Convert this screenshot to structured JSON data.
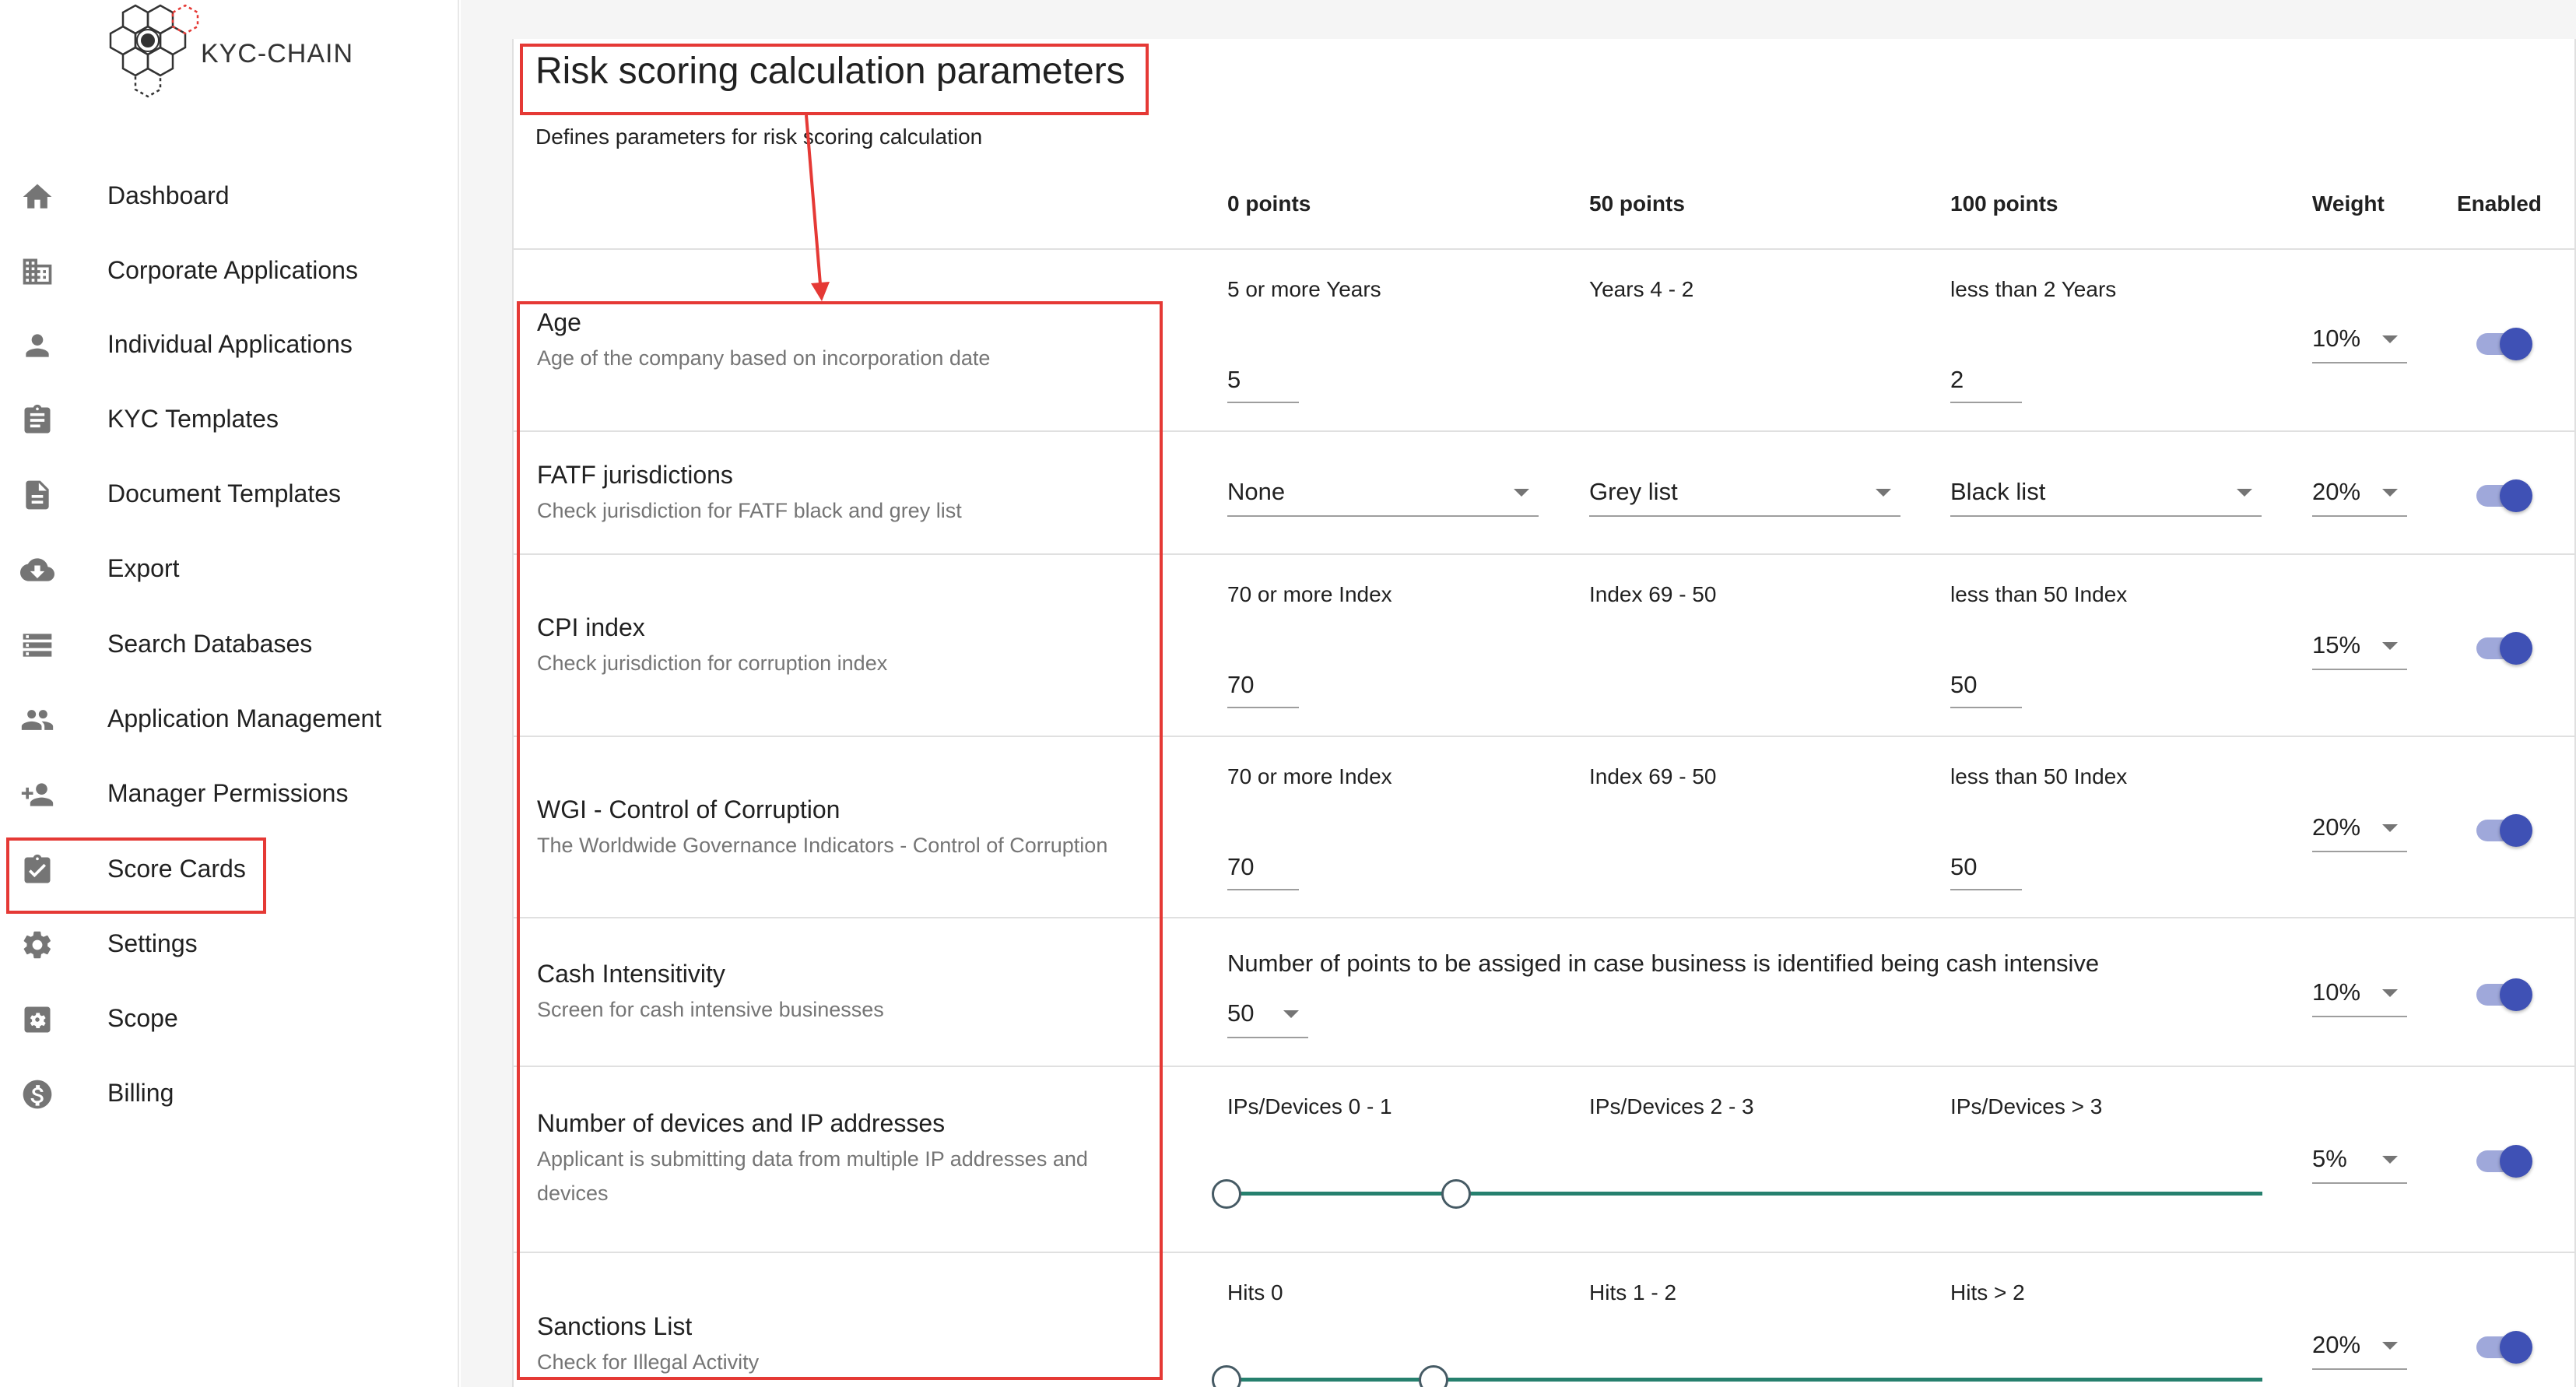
{
  "app": {
    "logo_text": "KYC-CHAIN"
  },
  "sidebar": {
    "items": [
      {
        "label": "Dashboard",
        "icon": "home-icon"
      },
      {
        "label": "Corporate Applications",
        "icon": "building-icon"
      },
      {
        "label": "Individual Applications",
        "icon": "person-icon"
      },
      {
        "label": "KYC Templates",
        "icon": "clipboard-icon"
      },
      {
        "label": "Document Templates",
        "icon": "document-icon"
      },
      {
        "label": "Export",
        "icon": "cloud-download-icon"
      },
      {
        "label": "Search Databases",
        "icon": "list-icon"
      },
      {
        "label": "Application Management",
        "icon": "people-icon"
      },
      {
        "label": "Manager Permissions",
        "icon": "add-people-icon"
      },
      {
        "label": "Score Cards",
        "icon": "clipboard-check-icon",
        "active": true
      },
      {
        "label": "Settings",
        "icon": "gear-icon"
      },
      {
        "label": "Scope",
        "icon": "scope-icon"
      },
      {
        "label": "Billing",
        "icon": "dollar-icon"
      }
    ]
  },
  "page": {
    "title": "Risk scoring calculation parameters",
    "subtitle": "Defines parameters for risk scoring calculation"
  },
  "columns": {
    "p0": "0 points",
    "p50": "50 points",
    "p100": "100 points",
    "weight": "Weight",
    "enabled": "Enabled"
  },
  "rows": {
    "age": {
      "title": "Age",
      "desc": "Age of the company based on incorporation date",
      "label0": "5 or more Years",
      "label50": "Years 4 - 2",
      "label100": "less than 2 Years",
      "value0": "5",
      "value100": "2",
      "weight": "10%",
      "enabled": true
    },
    "fatf": {
      "title": "FATF jurisdictions",
      "desc": "Check jurisdiction for FATF black and grey list",
      "select0": "None",
      "select50": "Grey list",
      "select100": "Black list",
      "weight": "20%",
      "enabled": true
    },
    "cpi": {
      "title": "CPI index",
      "desc": "Check jurisdiction for corruption index",
      "label0": "70 or more Index",
      "label50": "Index 69 - 50",
      "label100": "less than 50 Index",
      "value0": "70",
      "value100": "50",
      "weight": "15%",
      "enabled": true
    },
    "wgi": {
      "title": "WGI - Control of Corruption",
      "desc": "The Worldwide Governance Indicators - Control of Corruption",
      "label0": "70 or more Index",
      "label50": "Index 69 - 50",
      "label100": "less than 50 Index",
      "value0": "70",
      "value100": "50",
      "weight": "20%",
      "enabled": true
    },
    "cash": {
      "title": "Cash Intensitivity",
      "desc": "Screen for cash intensive businesses",
      "label": "Number of points to be assiged in case business is identified being cash intensive",
      "points": "50",
      "weight": "10%",
      "enabled": true
    },
    "devices": {
      "title": "Number of devices and IP addresses",
      "desc": "Applicant is submitting data from multiple IP addresses and devices",
      "label0": "IPs/Devices 0 - 1",
      "label50": "IPs/Devices 2 - 3",
      "label100": "IPs/Devices > 3",
      "range": [
        1,
        3
      ],
      "weight": "5%",
      "enabled": true
    },
    "sanctions": {
      "title": "Sanctions List",
      "desc": "Check for Illegal Activity",
      "label0": "Hits 0",
      "label50": "Hits 1 - 2",
      "label100": "Hits > 2",
      "weight": "20%",
      "enabled": true
    }
  },
  "colors": {
    "accent": "#3f51b5",
    "toggle_track": "#9fa8da",
    "slider_track": "#26806e",
    "annotation": "#e53935"
  }
}
